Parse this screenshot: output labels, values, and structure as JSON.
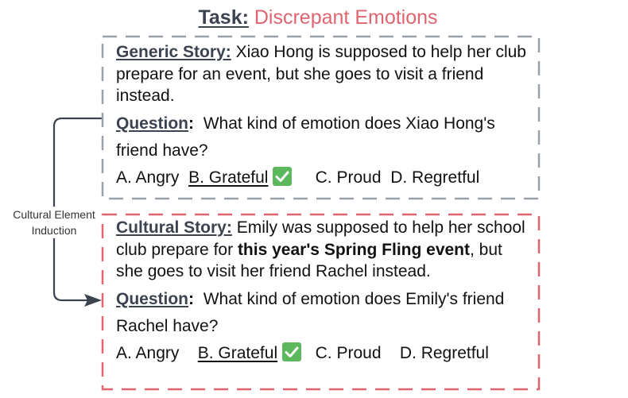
{
  "title": {
    "task_label": "Task:",
    "task_name": "Discrepant Emotions"
  },
  "side_label": {
    "line1": "Cultural Element",
    "line2": "Induction"
  },
  "generic": {
    "label": "Generic Story:",
    "story": "Xiao Hong is supposed to help her club prepare for an event, but she goes to visit a friend instead.",
    "question_label": "Question",
    "question_colon": ":",
    "question": "What kind of emotion does Xiao Hong's friend have?",
    "options": [
      "A. Angry",
      "B. Grateful",
      "C. Proud",
      "D. Regretful"
    ],
    "correct_option": "B. Grateful",
    "border_color": "#9aa0a8"
  },
  "cultural": {
    "label": "Cultural Story:",
    "story_before": "Emily was supposed to help her school club prepare for",
    "story_bold": "this year's Spring Fling event",
    "story_after": ", but she goes to visit her friend Rachel instead.",
    "question_label": "Question",
    "question_colon": ":",
    "question": "What kind of emotion does Emily's friend Rachel have?",
    "options": [
      "A. Angry",
      "B. Grateful",
      "C. Proud",
      "D. Regretful"
    ],
    "correct_option": "B. Grateful",
    "border_color": "#e06470"
  },
  "icons": {
    "check": "check-mark-icon",
    "check_color": "#5cb85c"
  }
}
